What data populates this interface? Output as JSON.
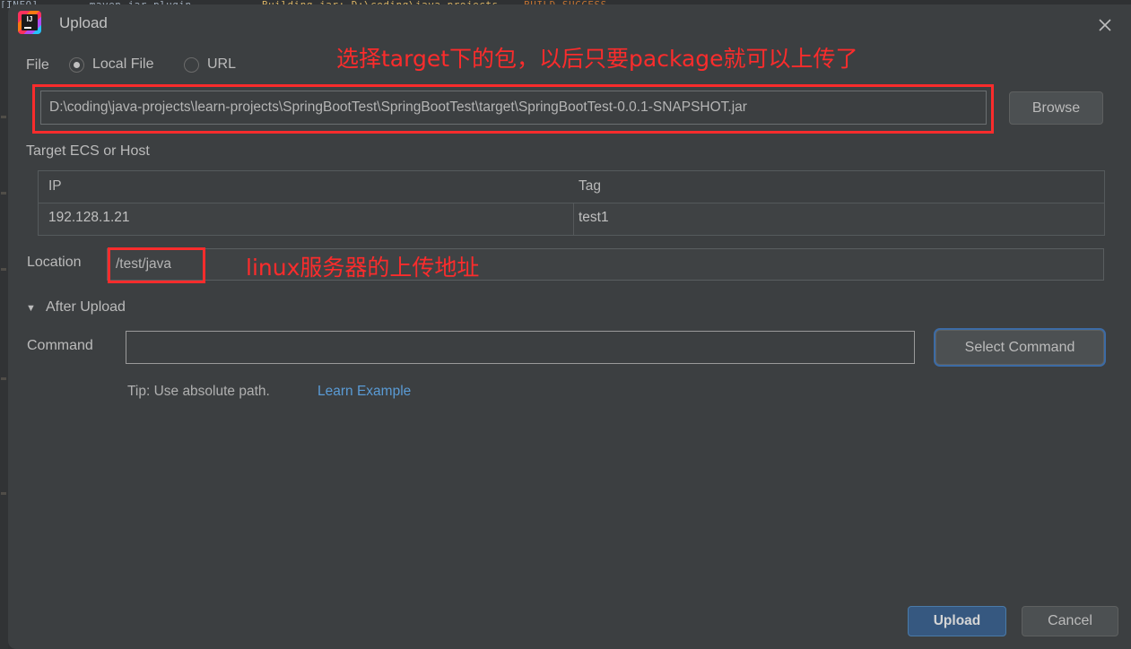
{
  "backdrop": {
    "console_text_1": "[INFO] ------ maven-jar-plugin ------",
    "console_text_2": "Building jar: D:\\coding\\java-projects",
    "console_text_3": "BUILD SUCCESS"
  },
  "titlebar": {
    "app_icon": "intellij-idea-icon",
    "title": "Upload",
    "close_icon": "close-icon"
  },
  "annotations": {
    "target_note": "选择target下的包，以后只要package就可以上传了",
    "location_note": "linux服务器的上传地址",
    "highlight_color": "#fb2c2c"
  },
  "file_row": {
    "label": "File",
    "options": [
      {
        "label": "Local File",
        "selected": true
      },
      {
        "label": "URL",
        "selected": false
      }
    ],
    "path_value": "D:\\coding\\java-projects\\learn-projects\\SpringBootTest\\SpringBootTest\\target\\SpringBootTest-0.0.1-SNAPSHOT.jar",
    "path_placeholder": "",
    "browse_label": "Browse"
  },
  "target_section": {
    "label": "Target ECS or Host",
    "columns": [
      "IP",
      "Tag"
    ],
    "rows": [
      {
        "ip": "192.128.1.21",
        "tag": "test1"
      }
    ]
  },
  "location_row": {
    "label": "Location",
    "value": "/test/java",
    "placeholder": ""
  },
  "after_upload": {
    "toggle_icon": "triangle-down-icon",
    "title": "After Upload",
    "command_label": "Command",
    "command_value": "",
    "command_placeholder": "",
    "select_command_label": "Select Command",
    "tip_text": "Tip: Use absolute path.",
    "tip_link": "Learn Example",
    "link_color": "#5a9bd5"
  },
  "footer": {
    "primary_label": "Upload",
    "primary_color": "#365880",
    "secondary_label": "Cancel"
  }
}
